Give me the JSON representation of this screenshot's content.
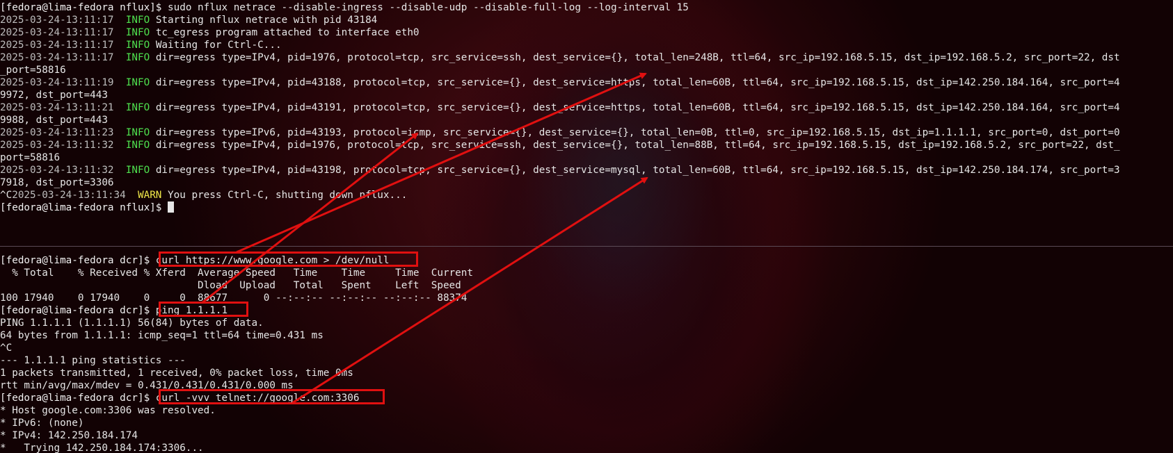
{
  "top_pane": {
    "command_prompt": "[fedora@lima-fedora nflux]$ ",
    "command": "sudo nflux netrace --disable-ingress --disable-udp --disable-full-log --log-interval 15",
    "log": [
      {
        "ts": "2025-03-24-13:11:17",
        "level": "INFO",
        "msg": "Starting nflux netrace with pid 43184"
      },
      {
        "ts": "2025-03-24-13:11:17",
        "level": "INFO",
        "msg": "tc_egress program attached to interface eth0"
      },
      {
        "ts": "2025-03-24-13:11:17",
        "level": "INFO",
        "msg": "Waiting for Ctrl-C..."
      },
      {
        "ts": "2025-03-24-13:11:17",
        "level": "INFO",
        "msg": "dir=egress type=IPv4, pid=1976, protocol=tcp, src_service=ssh, dest_service={}, total_len=248B, ttl=64, src_ip=192.168.5.15, dst_ip=192.168.5.2, src_port=22, dst",
        "wrap": "_port=58816"
      },
      {
        "ts": "2025-03-24-13:11:19",
        "level": "INFO",
        "msg": "dir=egress type=IPv4, pid=43188, protocol=tcp, src_service={}, dest_service=https, total_len=60B, ttl=64, src_ip=192.168.5.15, dst_ip=142.250.184.164, src_port=4",
        "wrap": "9972, dst_port=443"
      },
      {
        "ts": "2025-03-24-13:11:21",
        "level": "INFO",
        "msg": "dir=egress type=IPv4, pid=43191, protocol=tcp, src_service={}, dest_service=https, total_len=60B, ttl=64, src_ip=192.168.5.15, dst_ip=142.250.184.164, src_port=4",
        "wrap": "9988, dst_port=443"
      },
      {
        "ts": "2025-03-24-13:11:23",
        "level": "INFO",
        "msg": "dir=egress type=IPv6, pid=43193, protocol=icmp, src_service={}, dest_service={}, total_len=0B, ttl=0, src_ip=192.168.5.15, dst_ip=1.1.1.1, src_port=0, dst_port=0"
      },
      {
        "ts": "2025-03-24-13:11:32",
        "level": "INFO",
        "msg": "dir=egress type=IPv4, pid=1976, protocol=tcp, src_service=ssh, dest_service={}, total_len=88B, ttl=64, src_ip=192.168.5.15, dst_ip=192.168.5.2, src_port=22, dst_",
        "wrap": "port=58816"
      },
      {
        "ts": "2025-03-24-13:11:32",
        "level": "INFO",
        "msg": "dir=egress type=IPv4, pid=43198, protocol=tcp, src_service={}, dest_service=mysql, total_len=60B, ttl=64, src_ip=192.168.5.15, dst_ip=142.250.184.174, src_port=3",
        "wrap": "7918, dst_port=3306"
      }
    ],
    "warn_prefix": "^C",
    "warn_ts": "2025-03-24-13:11:34 ",
    "warn_level": "WARN",
    "warn_msg": " You press Ctrl-C, shutting down nflux...",
    "final_prompt": "[fedora@lima-fedora nflux]$ "
  },
  "bottom_pane": {
    "prompt": "[fedora@lima-fedora dcr]$ ",
    "cmd_curl": "curl https://www.google.com > /dev/null",
    "curl_header1": "  % Total    % Received % Xferd  Average Speed   Time    Time     Time  Current",
    "curl_header2": "                                 Dload  Upload   Total   Spent    Left  Speed",
    "curl_progress": "100 17940    0 17940    0     0  88677      0 --:--:-- --:--:-- --:--:-- 88374",
    "cmd_ping": "ping 1.1.1.1",
    "ping_out": [
      "PING 1.1.1.1 (1.1.1.1) 56(84) bytes of data.",
      "64 bytes from 1.1.1.1: icmp_seq=1 ttl=64 time=0.431 ms",
      "^C",
      "--- 1.1.1.1 ping statistics ---",
      "1 packets transmitted, 1 received, 0% packet loss, time 0ms",
      "rtt min/avg/max/mdev = 0.431/0.431/0.431/0.000 ms"
    ],
    "cmd_telnet": "curl -vvv telnet://google.com:3306",
    "telnet_out": [
      "* Host google.com:3306 was resolved.",
      "* IPv6: (none)",
      "* IPv4: 142.250.184.174",
      "*   Trying 142.250.184.174:3306..."
    ]
  },
  "annotation_color": "#e01010"
}
